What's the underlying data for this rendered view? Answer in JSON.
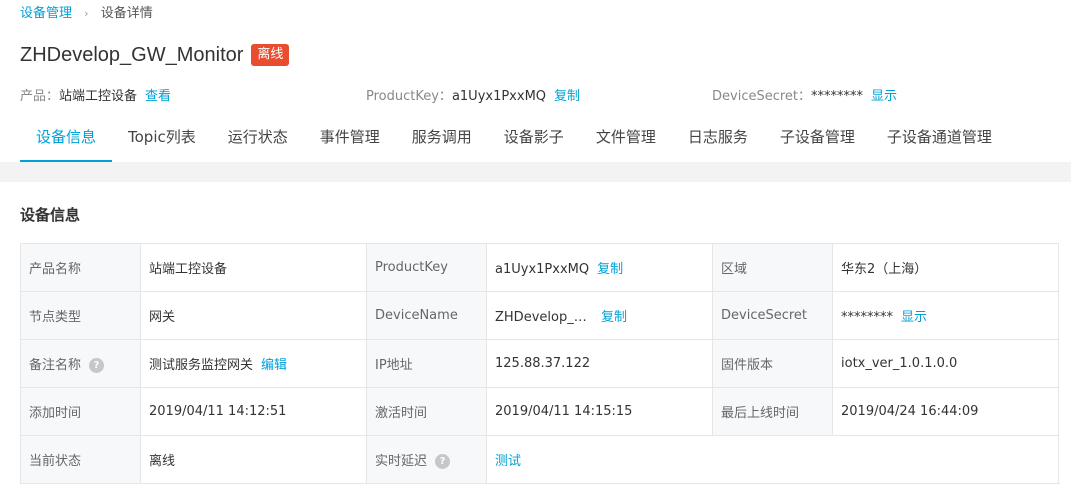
{
  "breadcrumb": {
    "parent": "设备管理",
    "separator": "›",
    "current": "设备详情"
  },
  "device": {
    "name": "ZHDevelop_GW_Monitor",
    "status_badge": "离线"
  },
  "meta": {
    "product_label": "产品：",
    "product_value": "站端工控设备",
    "product_link": "查看",
    "productkey_label": "ProductKey：",
    "productkey_value": "a1Uyx1PxxMQ",
    "productkey_link": "复制",
    "secret_label": "DeviceSecret：",
    "secret_value": "********",
    "secret_link": "显示"
  },
  "tabs": [
    "设备信息",
    "Topic列表",
    "运行状态",
    "事件管理",
    "服务调用",
    "设备影子",
    "文件管理",
    "日志服务",
    "子设备管理",
    "子设备通道管理"
  ],
  "section_title": "设备信息",
  "info": {
    "r1": {
      "l1": "产品名称",
      "v1": "站端工控设备",
      "l2": "ProductKey",
      "v2": "a1Uyx1PxxMQ",
      "a2": "复制",
      "l3": "区域",
      "v3": "华东2（上海）"
    },
    "r2": {
      "l1": "节点类型",
      "v1": "网关",
      "l2": "DeviceName",
      "v2": "ZHDevelop_GW_Monitor",
      "a2": "复制",
      "l3": "DeviceSecret",
      "v3": "********",
      "a3": "显示"
    },
    "r3": {
      "l1": "备注名称",
      "v1": "测试服务监控网关",
      "a1": "编辑",
      "l2": "IP地址",
      "v2": "125.88.37.122",
      "l3": "固件版本",
      "v3": "iotx_ver_1.0.1.0.0"
    },
    "r4": {
      "l1": "添加时间",
      "v1": "2019/04/11 14:12:51",
      "l2": "激活时间",
      "v2": "2019/04/11 14:15:15",
      "l3": "最后上线时间",
      "v3": "2019/04/24 16:44:09"
    },
    "r5": {
      "l1": "当前状态",
      "v1": "离线",
      "l2": "实时延迟",
      "a2": "测试"
    }
  },
  "help_icon_glyph": "?",
  "colors": {
    "accent": "#00a1d6",
    "offline_badge": "#e84d2f"
  }
}
